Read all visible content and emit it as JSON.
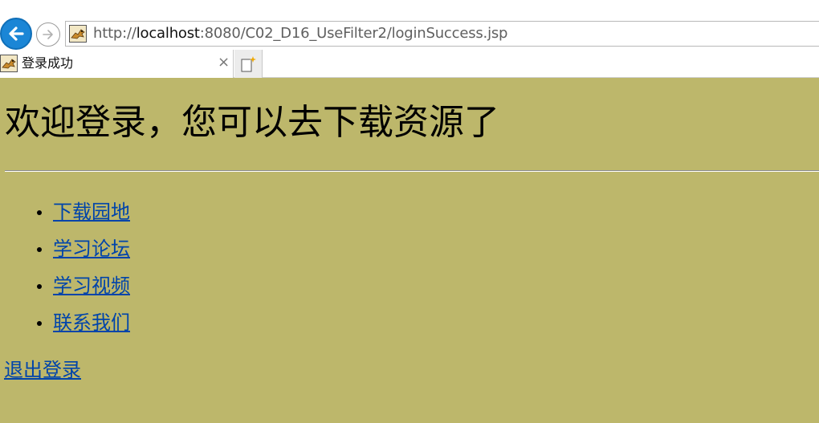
{
  "browser": {
    "url_scheme": "http://",
    "url_host": "localhost",
    "url_rest": ":8080/C02_D16_UseFilter2/loginSuccess.jsp",
    "tab_title": "登录成功",
    "tab_close": "×",
    "icons": {
      "back": "back-arrow-icon",
      "forward": "forward-arrow-icon",
      "favicon": "tomcat-favicon-icon",
      "new_tab": "new-tab-icon"
    },
    "accent_color": "#1b86d6"
  },
  "page": {
    "background_color": "#bdb76b",
    "heading": "欢迎登录，您可以去下载资源了",
    "links": [
      {
        "label": "下载园地"
      },
      {
        "label": "学习论坛"
      },
      {
        "label": "学习视频"
      },
      {
        "label": "联系我们"
      }
    ],
    "logout_label": "退出登录"
  }
}
